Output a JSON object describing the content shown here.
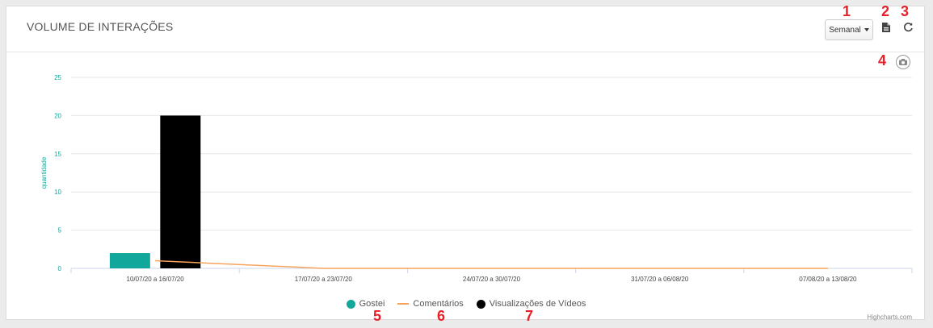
{
  "header": {
    "title": "VOLUME DE INTERAÇÕES",
    "period_label": "Semanal"
  },
  "markers": [
    "1",
    "2",
    "3",
    "4",
    "5",
    "6",
    "7"
  ],
  "colors": {
    "gostei": "#11a79a",
    "comentarios": "#f7a35c",
    "videos": "#000000",
    "axis_text": "#11a79a"
  },
  "icons": {
    "export": "file-pdf-icon",
    "refresh": "refresh-icon",
    "camera": "camera-icon"
  },
  "credits": "Highcharts.com",
  "chart_data": {
    "type": "bar",
    "categories": [
      "10/07/20 a 16/07/20",
      "17/07/20 a 23/07/20",
      "24/07/20 a 30/07/20",
      "31/07/20 a 06/08/20",
      "07/08/20 a 13/08/20"
    ],
    "ylabel": "quantidade",
    "xlabel": "",
    "ylim": [
      0,
      25
    ],
    "yticks": [
      0,
      5,
      10,
      15,
      20,
      25
    ],
    "grid": true,
    "legend_position": "bottom-center",
    "series": [
      {
        "name": "Gostei",
        "type": "column",
        "values": [
          2,
          0,
          0,
          0,
          0
        ]
      },
      {
        "name": "Comentários",
        "type": "line",
        "values": [
          1,
          0,
          0,
          0,
          0
        ]
      },
      {
        "name": "Visualizações de Vídeos",
        "type": "column",
        "values": [
          20,
          0,
          0,
          0,
          0
        ]
      }
    ]
  }
}
